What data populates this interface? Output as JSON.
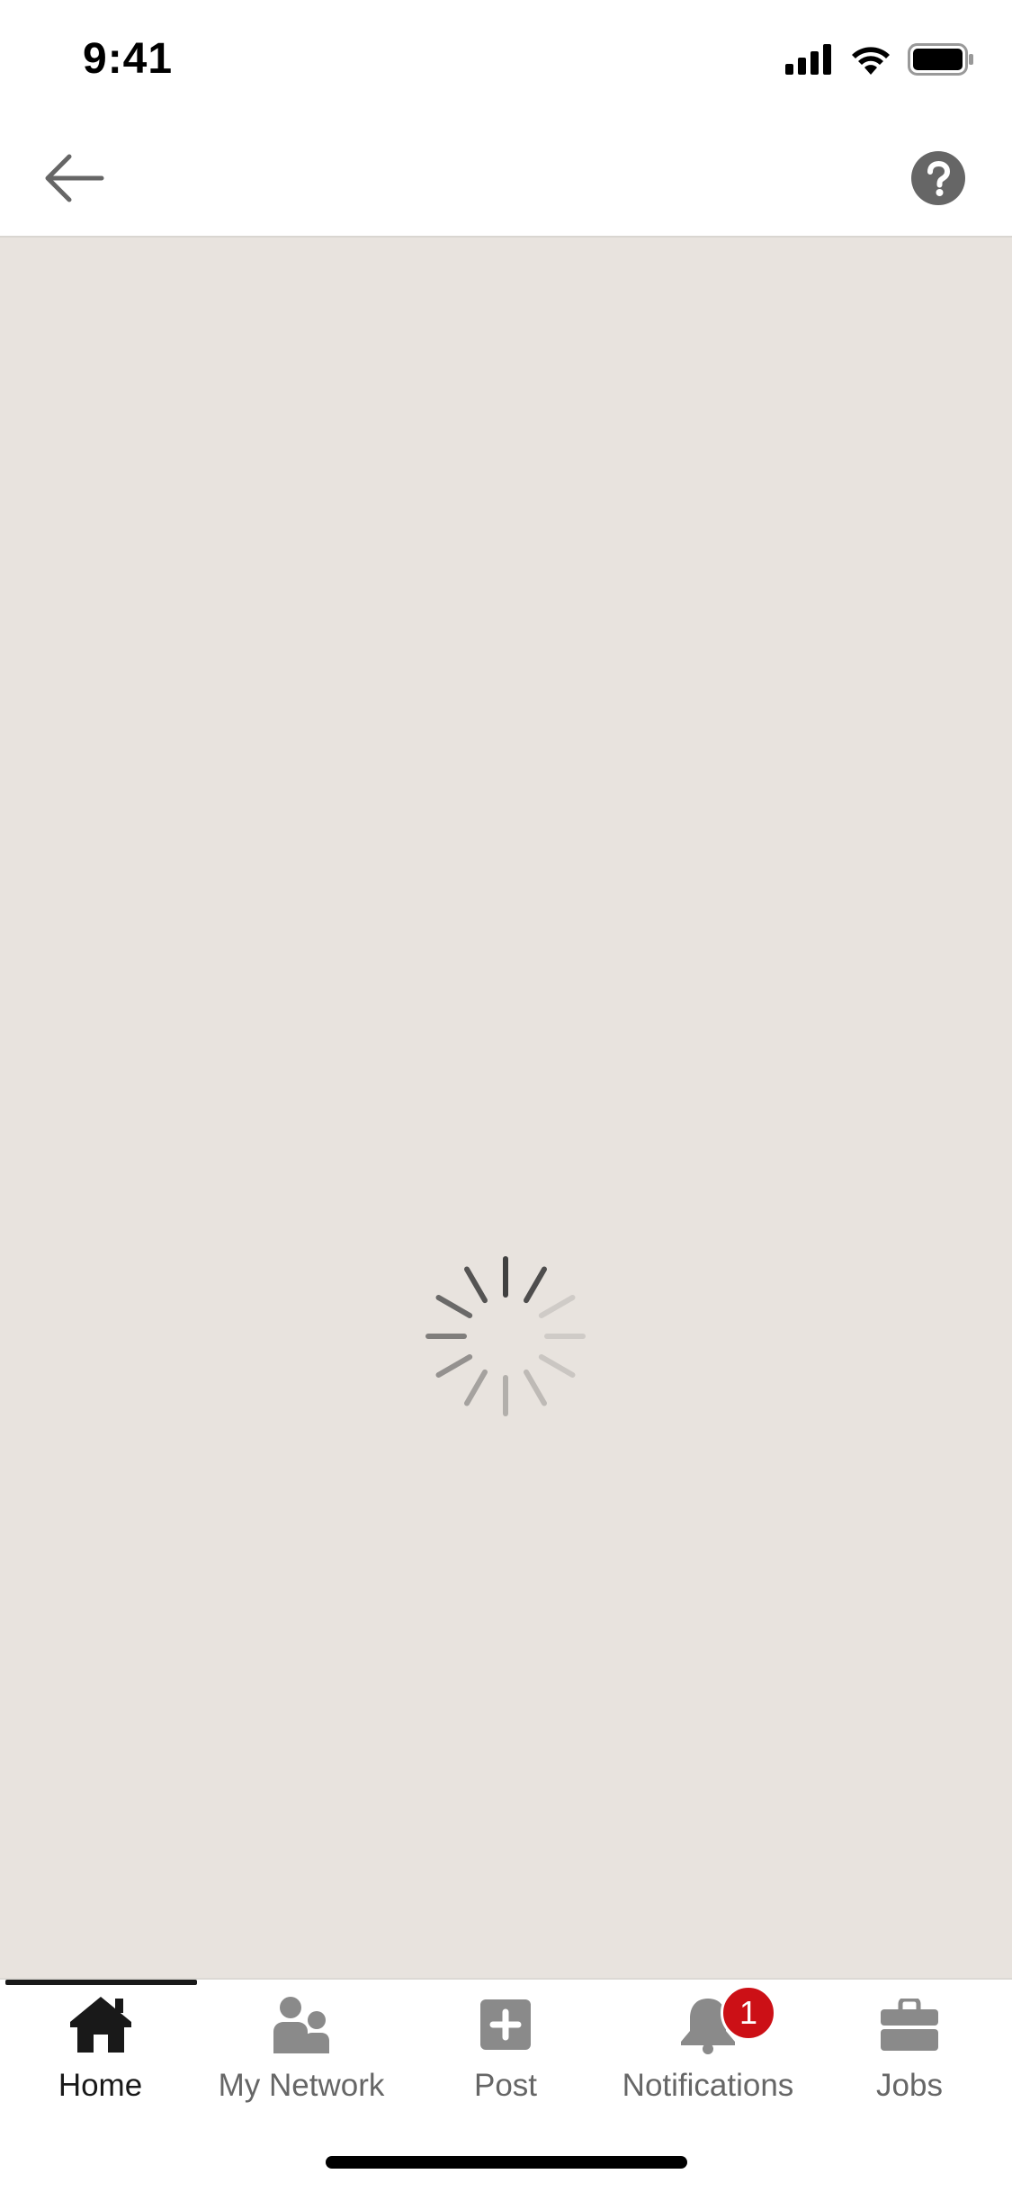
{
  "status_bar": {
    "time": "9:41"
  },
  "top_nav": {
    "back_icon": "arrow-left-icon",
    "help_icon": "question-circle-icon"
  },
  "content": {
    "state": "loading",
    "spinner_icon": "activity-spinner-icon",
    "background_color": "#e8e3de"
  },
  "tab_bar": {
    "active_tab": "Home",
    "tabs": [
      {
        "label": "Home",
        "icon": "home-icon"
      },
      {
        "label": "My Network",
        "icon": "people-icon"
      },
      {
        "label": "Post",
        "icon": "plus-square-icon"
      },
      {
        "label": "Notifications",
        "icon": "bell-icon",
        "badge": "1"
      },
      {
        "label": "Jobs",
        "icon": "briefcase-icon"
      }
    ]
  },
  "colors": {
    "badge": "#cc1016",
    "active": "#191919",
    "inactive": "#666666"
  }
}
